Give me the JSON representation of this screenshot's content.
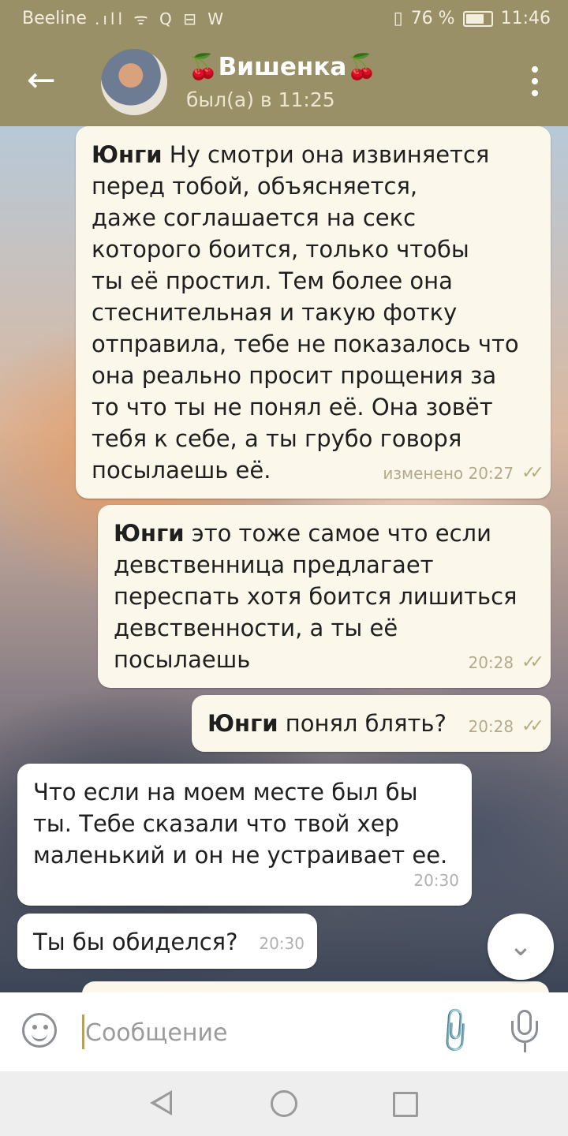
{
  "status_bar": {
    "carrier": "Beeline",
    "left_icons": ".ıll ᯤ Q ⊟ W",
    "vibrate": "▯",
    "battery": "76 %",
    "time": "11:46"
  },
  "header": {
    "back_icon": "arrow-left-icon",
    "title": "🍒Вишенка🍒",
    "status": "был(а) в 11:25"
  },
  "messages": [
    {
      "sender": "Юнги",
      "text": " Ну смотри она извиняется\nперед тобой, объясняется,\nдаже соглашается на секс\nкоторого боится, только чтобы\nты её простил. Тем более она\nстеснительная и такую фотку\nотправила, тебе не показалось что\nона реально просит прощения за\nто что ты не понял её. Она зовёт\nтебя к себе, а ты грубо говоря\nпосылаешь её.",
      "time": "изменено 20:27",
      "outgoing": true
    },
    {
      "sender": "Юнги",
      "text": " это тоже самое что если\nдевственница предлагает\nпереспать хотя боится лишиться\nдевственности, а ты её\nпосылаешь",
      "time": "20:28",
      "outgoing": true
    },
    {
      "sender": "Юнги",
      "text": " понял блять?",
      "time": "20:28",
      "outgoing": true
    },
    {
      "text": "Что если на моем месте был бы\nты. Тебе сказали что твой хер\nмаленький и он не устраивает ее.",
      "time": "20:30",
      "outgoing": false
    },
    {
      "text": "Ты бы обиделся?",
      "time": "20:30",
      "outgoing": false
    }
  ],
  "input": {
    "placeholder": "Сообщение"
  },
  "colors": {
    "header": "#9a9068",
    "outgoing_bubble": "#fbf7ea",
    "incoming_bubble": "#ffffff",
    "checks": "#b5ad82"
  }
}
